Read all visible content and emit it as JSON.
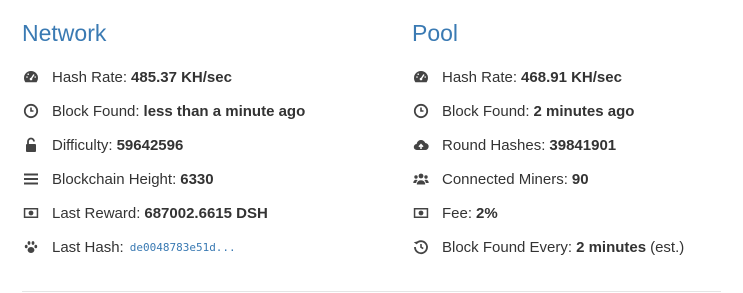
{
  "network": {
    "title": "Network",
    "hash_rate": {
      "label": "Hash Rate:",
      "value": "485.37 KH/sec",
      "icon": "dashboard-icon"
    },
    "block_found": {
      "label": "Block Found:",
      "value": "less than a minute ago",
      "icon": "clock-icon"
    },
    "difficulty": {
      "label": "Difficulty:",
      "value": "59642596",
      "icon": "unlock-icon"
    },
    "height": {
      "label": "Blockchain Height:",
      "value": "6330",
      "icon": "bars-icon"
    },
    "reward": {
      "label": "Last Reward:",
      "value": "687002.6615 DSH",
      "icon": "money-icon"
    },
    "last_hash": {
      "label": "Last Hash:",
      "value": "de0048783e51d...",
      "icon": "paw-icon"
    }
  },
  "pool": {
    "title": "Pool",
    "hash_rate": {
      "label": "Hash Rate:",
      "value": "468.91 KH/sec",
      "icon": "dashboard-icon"
    },
    "block_found": {
      "label": "Block Found:",
      "value": "2 minutes ago",
      "icon": "clock-icon"
    },
    "round_hashes": {
      "label": "Round Hashes:",
      "value": "39841901",
      "icon": "cloud-upload-icon"
    },
    "miners": {
      "label": "Connected Miners:",
      "value": "90",
      "icon": "users-icon"
    },
    "fee": {
      "label": "Fee:",
      "value": "2%",
      "icon": "money-icon"
    },
    "block_every": {
      "label": "Block Found Every:",
      "value": "2 minutes",
      "suffix": "(est.)",
      "icon": "history-icon"
    }
  }
}
